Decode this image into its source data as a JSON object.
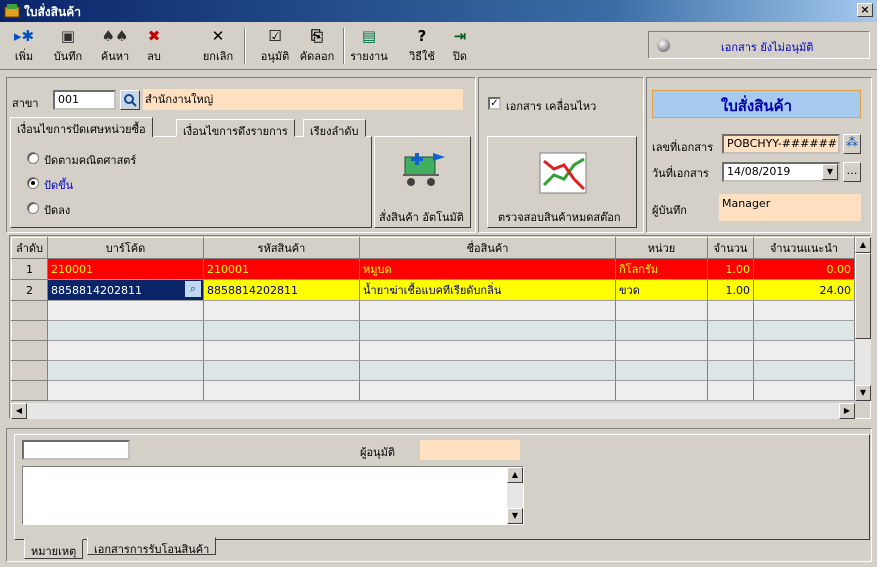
{
  "window": {
    "title": "ใบสั่งสินค้า",
    "close": "×"
  },
  "toolbar": [
    {
      "icon": "add-icon",
      "glyph": "▸✱",
      "label": "เพิ่ม"
    },
    {
      "icon": "save-icon",
      "glyph": "▣",
      "label": "บันทึก"
    },
    {
      "icon": "binoculars-icon",
      "glyph": "♠♠",
      "label": "ค้นหา"
    },
    {
      "icon": "delete-icon",
      "glyph": "✖",
      "label": "ลบ"
    },
    {
      "icon": "cancel-icon",
      "glyph": "✕",
      "label": "ยกเลิก"
    },
    {
      "icon": "approve-icon",
      "glyph": "☑",
      "label": "อนุมัติ"
    },
    {
      "icon": "copy-icon",
      "glyph": "⎘",
      "label": "คัดลอก"
    },
    {
      "icon": "report-icon",
      "glyph": "▤",
      "label": "รายงาน"
    },
    {
      "icon": "help-icon",
      "glyph": "?",
      "label": "วิธีใช้"
    },
    {
      "icon": "exit-icon",
      "glyph": "⇥",
      "label": "ปิด"
    }
  ],
  "status": {
    "text": "เอกสาร ยังไม่อนุมัติ"
  },
  "branch": {
    "label": "สาขา",
    "code": "001",
    "name": "สำนักงานใหญ่"
  },
  "tabs": [
    "เงื่อนไขการปัดเศษหน่วยซื้อ",
    "เงื่อนไขการดึงรายการ",
    "เรียงลำดับ"
  ],
  "rounding": {
    "options": [
      "ปัดตามคณิตศาสตร์",
      "ปัดขึ้น",
      "ปัดลง"
    ],
    "selected": 1
  },
  "auto_order": {
    "label": "สั่งสินค้า อัตโนมัติ"
  },
  "moving_doc": {
    "label": "เอกสาร เคลื่อนไหว",
    "checked": true
  },
  "stock_check": {
    "label": "ตรวจสอบสินค้าหมดสต๊อก"
  },
  "doc": {
    "title": "ใบสั่งสินค้า",
    "no_label": "เลขที่เอกสาร",
    "no_value": "POBCHYY-######",
    "date_label": "วันที่เอกสาร",
    "date_value": "14/08/2019",
    "recorder_label": "ผู้บันทึก",
    "recorder_value": "Manager"
  },
  "grid": {
    "headers": [
      "ลำดับ",
      "บาร์โค้ด",
      "รหัสสินค้า",
      "ชื่อสินค้า",
      "หน่วย",
      "จำนวน",
      "จำนวนแนะนำ"
    ],
    "rows": [
      {
        "no": "1",
        "barcode": "210001",
        "code": "210001",
        "name": "หมูบด",
        "unit": "กิโลกรัม",
        "qty": "1.00",
        "suggest": "0.00"
      },
      {
        "no": "2",
        "barcode": "8858814202811",
        "code": "8858814202811",
        "name": "น้ำยาฆ่าเชื้อแบคทีเรียดับกลิ่น",
        "unit": "ขวด",
        "qty": "1.00",
        "suggest": "24.00"
      }
    ]
  },
  "bottom": {
    "approver_label": "ผู้อนุมัติ",
    "tabs": [
      "หมายเหตุ",
      "เอกสารการรับโอนสินค้า"
    ]
  }
}
